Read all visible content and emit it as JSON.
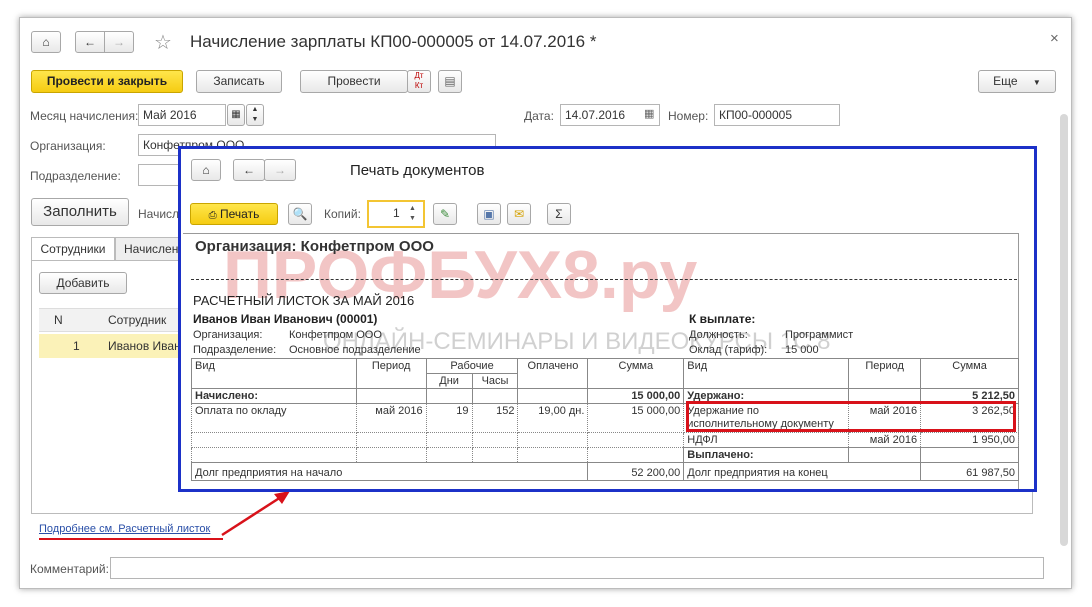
{
  "window": {
    "title": "Начисление зарплаты КП00-000005 от 14.07.2016 *",
    "close": "×"
  },
  "toolbar": {
    "post_close": "Провести и закрыть",
    "save": "Записать",
    "post": "Провести",
    "more": "Еще"
  },
  "form": {
    "month_label": "Месяц начисления:",
    "month_value": "Май 2016",
    "date_label": "Дата:",
    "date_value": "14.07.2016",
    "number_label": "Номер:",
    "number_value": "КП00-000005",
    "org_label": "Организация:",
    "org_value": "Конфетпром ООО",
    "dept_label": "Подразделение:",
    "fill_button": "Заполнить",
    "accrual_partial": "Начисл",
    "comment_label": "Комментарий:"
  },
  "tabs": [
    {
      "label": "Сотрудники"
    },
    {
      "label": "Начислен"
    }
  ],
  "employees": {
    "add_button": "Добавить",
    "col_n": "N",
    "col_employee": "Сотрудник",
    "rows": [
      {
        "n": "1",
        "name": "Иванов Иван"
      }
    ]
  },
  "link": {
    "payslip": "Подробнее см. Расчетный листок"
  },
  "print_window": {
    "title": "Печать документов",
    "print_button": "Печать",
    "copies_label": "Копий:",
    "copies_value": "1",
    "sigma": "Σ"
  },
  "payslip": {
    "org_header": "Организация: Конфетпром ООО",
    "title": "РАСЧЕТНЫЙ ЛИСТОК ЗА МАЙ 2016",
    "employee": "Иванов Иван Иванович (00001)",
    "org_label": "Организация:",
    "org_value": "Конфетпром ООО",
    "dept_label": "Подразделение:",
    "dept_value": "Основное подразделение",
    "to_pay_label": "К выплате:",
    "position_label": "Должность:",
    "position_value": "Программист",
    "salary_label": "Оклад (тариф):",
    "salary_value": "15 000",
    "h_kind": "Вид",
    "h_period": "Период",
    "h_working": "Рабочие",
    "h_days": "Дни",
    "h_hours": "Часы",
    "h_paid": "Оплачено",
    "h_sum": "Сумма",
    "h_kind2": "Вид",
    "h_period2": "Период",
    "h_sum2": "Сумма",
    "accrued_label": "Начислено:",
    "accrued_total": "15 000,00",
    "withheld_label": "Удержано:",
    "withheld_total": "5 212,50",
    "row1_kind": "Оплата по окладу",
    "row1_period": "май 2016",
    "row1_days": "19",
    "row1_hours": "152",
    "row1_paid": "19,00 дн.",
    "row1_sum": "15 000,00",
    "ded1_kind_a": "Удержание по",
    "ded1_kind_b": "исполнительному документу",
    "ded1_period": "май 2016",
    "ded1_sum": "3 262,50",
    "ded2_kind": "НДФЛ",
    "ded2_period": "май 2016",
    "ded2_sum": "1 950,00",
    "paid_out_label": "Выплачено:",
    "debt_start_label": "Долг предприятия на начало",
    "debt_start_value": "52 200,00",
    "debt_end_label": "Долг предприятия на конец",
    "debt_end_value": "61 987,50"
  },
  "watermark": {
    "main": "ПРОФБУХ8.ру",
    "sub": "ОНЛАЙН-СЕМИНАРЫ И ВИДЕОКУРСЫ 1С:8"
  },
  "colors": {
    "highlight_red": "#d8121a",
    "print_window_border": "#1c31c8",
    "accent_yellow": "#f5cc12",
    "selected_row": "#fbf2b8"
  }
}
